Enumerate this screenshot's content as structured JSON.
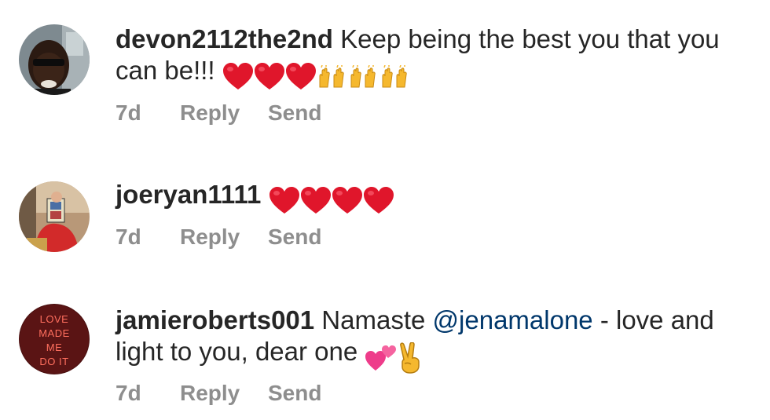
{
  "comments": [
    {
      "username": "devon2112the2nd",
      "text_before_emoji": " Keep being the best you that you can be!!!",
      "emojis": [
        "heart",
        "heart",
        "heart",
        "raising-hands",
        "raising-hands",
        "raising-hands"
      ],
      "age": "7d",
      "reply_label": "Reply",
      "send_label": "Send"
    },
    {
      "username": "joeryan1111",
      "text_before_emoji": "",
      "emojis": [
        "heart",
        "heart",
        "heart",
        "heart"
      ],
      "age": "7d",
      "reply_label": "Reply",
      "send_label": "Send"
    },
    {
      "username": "jamieroberts001",
      "text_prefix": " Namaste ",
      "mention": "@jenamalone",
      "text_suffix": " - love and light to you, dear one",
      "emojis": [
        "two-hearts",
        "victory-hand"
      ],
      "age": "7d",
      "reply_label": "Reply",
      "send_label": "Send",
      "avatar_sign": [
        "LOVE",
        "MADE",
        "ME",
        "DO IT"
      ]
    }
  ],
  "colors": {
    "text": "#262626",
    "meta": "#8e8e8e",
    "mention": "#00376b",
    "heart": "#e0162b"
  }
}
